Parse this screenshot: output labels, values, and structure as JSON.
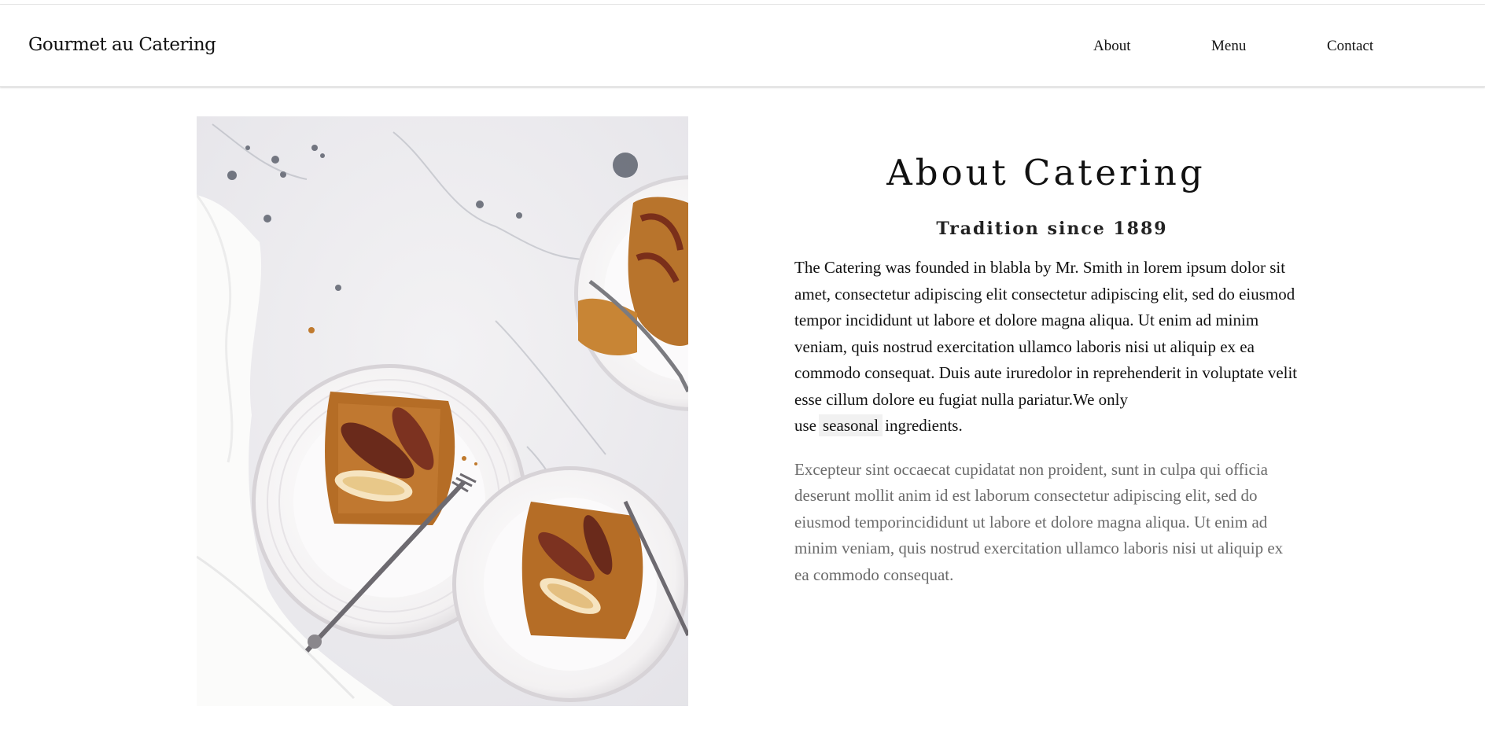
{
  "header": {
    "brand": "Gourmet au Catering",
    "nav": [
      {
        "label": "About"
      },
      {
        "label": "Menu"
      },
      {
        "label": "Contact"
      }
    ]
  },
  "about": {
    "image_icon": "food-photo",
    "title": "About Catering",
    "subtitle": "Tradition since 1889",
    "paragraph1_text": "The Catering was founded in blabla by Mr. Smith in lorem ipsum dolor sit amet, consectetur adipiscing elit consectetur adipiscing elit, sed do eiusmod tempor incididunt ut labore et dolore magna aliqua. Ut enim ad minim veniam, quis nostrud exercitation ullamco laboris nisi ut aliquip ex ea commodo consequat. Duis aute iruredolor in reprehenderit in voluptate velit esse cillum dolore eu fugiat nulla pariatur.We only use",
    "paragraph1_tag": "seasonal",
    "paragraph1_end": "ingredients.",
    "paragraph2": "Excepteur sint occaecat cupidatat non proident, sunt in culpa qui officia deserunt mollit anim id est laborum consectetur adipiscing elit, sed do eiusmod temporincididunt ut labore et dolore magna aliqua. Ut enim ad minim veniam, quis nostrud exercitation ullamco laboris nisi ut aliquip ex ea commodo consequat."
  },
  "colors": {
    "text": "#111111",
    "muted_text": "#6a6a6a",
    "tag_bg": "#f1f1f1",
    "divider": "#cfcfcf"
  }
}
